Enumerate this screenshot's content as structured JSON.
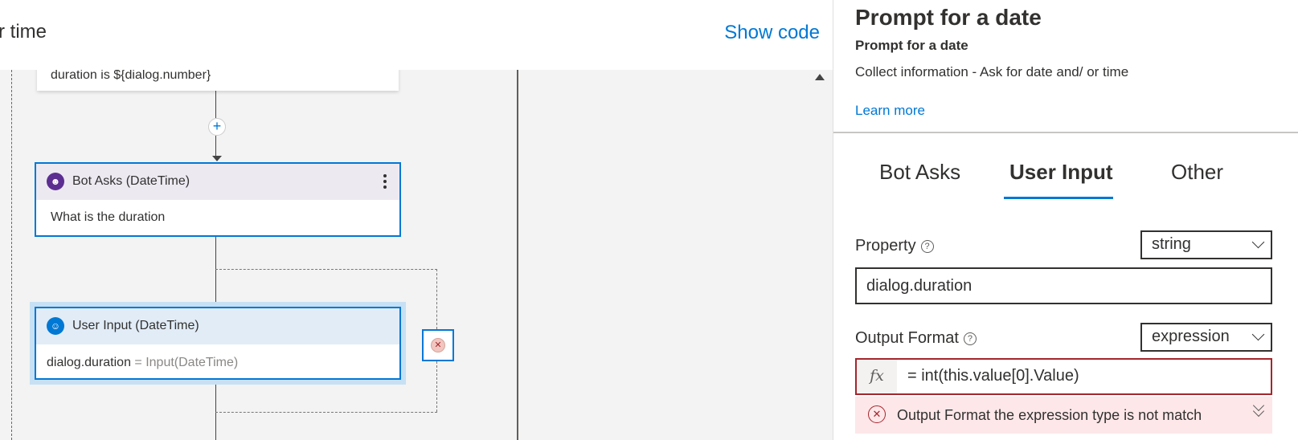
{
  "canvas": {
    "dialog_title": "r time",
    "show_code_label": "Show code",
    "previous_node_text": "duration is ${dialog.number}",
    "add_button": "+",
    "bot_asks": {
      "title": "Bot Asks (DateTime)",
      "body": "What is the duration"
    },
    "user_input": {
      "title": "User Input (DateTime)",
      "body_property": "dialog.duration",
      "body_expression": " = Input(DateTime)"
    }
  },
  "panel": {
    "title": "Prompt for a date",
    "subtitle": "Prompt for a date",
    "description": "Collect information - Ask for date and/ or time",
    "learn_more": "Learn more",
    "tabs": [
      {
        "label": "Bot Asks",
        "active": false
      },
      {
        "label": "User Input",
        "active": true
      },
      {
        "label": "Other",
        "active": false
      }
    ],
    "property": {
      "label": "Property",
      "type_value": "string",
      "value": "dialog.duration"
    },
    "output_format": {
      "label": "Output Format",
      "type_value": "expression",
      "fx_label": "fx",
      "value": "= int(this.value[0].Value)",
      "error": "Output Format the expression type is not match"
    }
  },
  "colors": {
    "accent": "#0078d4",
    "error": "#a4262c",
    "error_bg": "#fde7e9",
    "bot_icon": "#5c2e91"
  }
}
